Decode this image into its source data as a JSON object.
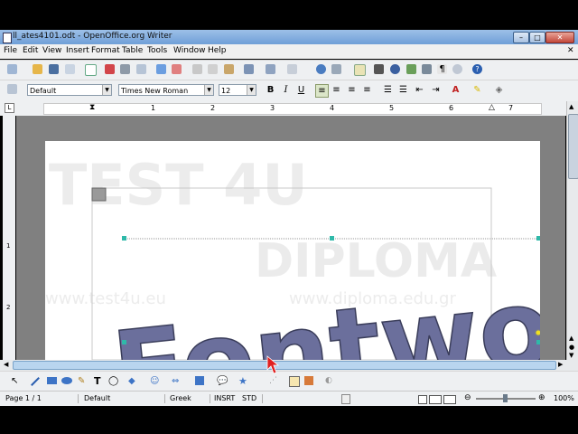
{
  "window": {
    "title": "ll_ates4101.odt - OpenOffice.org Writer"
  },
  "menus": [
    "File",
    "Edit",
    "View",
    "Insert",
    "Format",
    "Table",
    "Tools",
    "Window",
    "Help"
  ],
  "formatting": {
    "paragraph_style": "Default",
    "font_name": "Times New Roman",
    "font_size": "12",
    "bold": "B",
    "italic": "I",
    "underline": "U"
  },
  "ruler": {
    "numbers": [
      "1",
      "2",
      "3",
      "4",
      "5",
      "6",
      "7"
    ]
  },
  "vruler": {
    "numbers": [
      "1",
      "2"
    ]
  },
  "document": {
    "fontwork_text": "Fontwork",
    "watermark_logo": "TEST 4U",
    "watermark_diploma": "DIPLOMA",
    "watermark_url_1": "www.test4u.eu",
    "watermark_url_2": "www.diploma.edu.gr"
  },
  "statusbar": {
    "page": "Page 1 / 1",
    "style": "Default",
    "language": "Greek",
    "insert_mode": "INSRT",
    "selection_mode": "STD",
    "zoom": "100%"
  },
  "colors": {
    "titlebar": "#7aa7dd",
    "fontwork_fill": "#6b6f9c",
    "handle": "#2fb9a9",
    "cursor": "#e02020"
  }
}
